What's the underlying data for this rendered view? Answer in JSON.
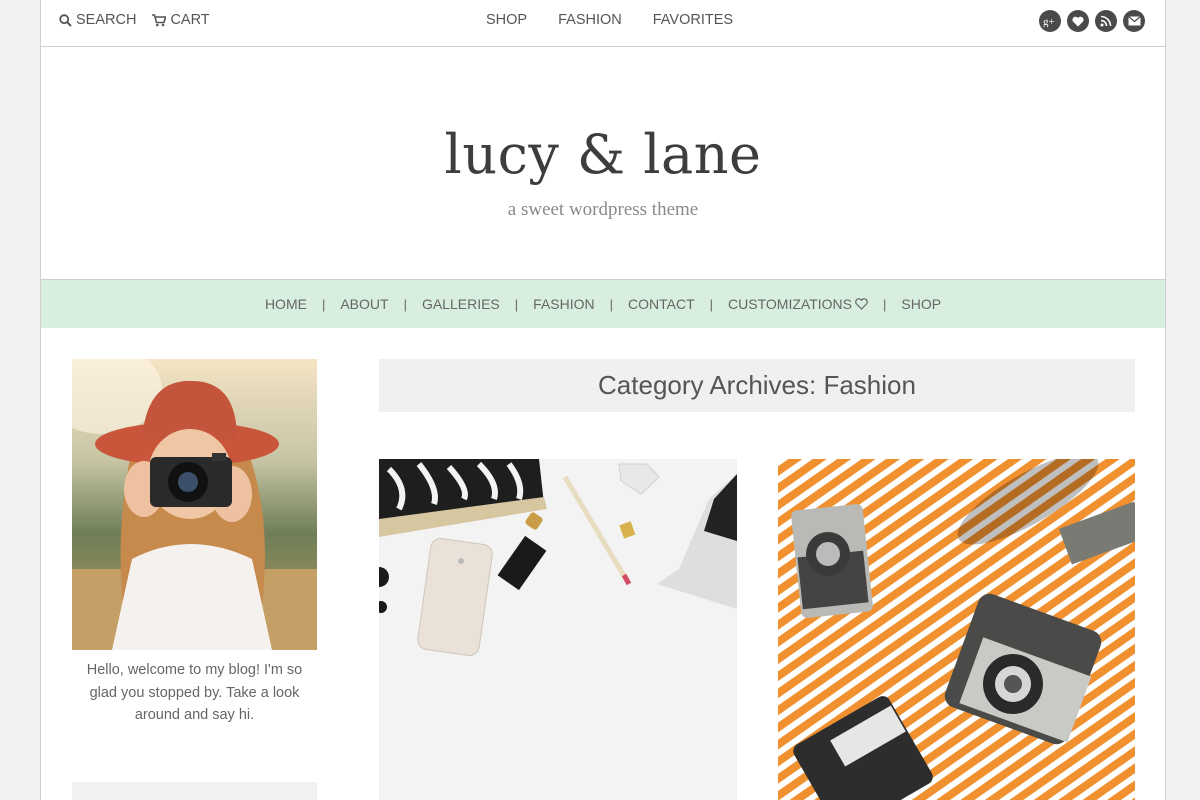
{
  "topbar": {
    "search_label": "SEARCH",
    "cart_label": "CART",
    "links": [
      "SHOP",
      "FASHION",
      "FAVORITES"
    ],
    "social_icons": [
      "google-plus-icon",
      "bloglovin-heart-icon",
      "rss-icon",
      "email-icon"
    ]
  },
  "header": {
    "title": "lucy & lane",
    "tagline": "a sweet wordpress theme"
  },
  "mainnav": {
    "items": [
      "HOME",
      "ABOUT",
      "GALLERIES",
      "FASHION",
      "CONTACT",
      "CUSTOMIZATIONS",
      "SHOP"
    ],
    "accent": "#d8eedf"
  },
  "sidebar": {
    "welcome_text": "Hello, welcome to my blog! I'm so glad you stopped by. Take a look around and say hi."
  },
  "main": {
    "archive_title": "Category Archives: Fashion"
  }
}
